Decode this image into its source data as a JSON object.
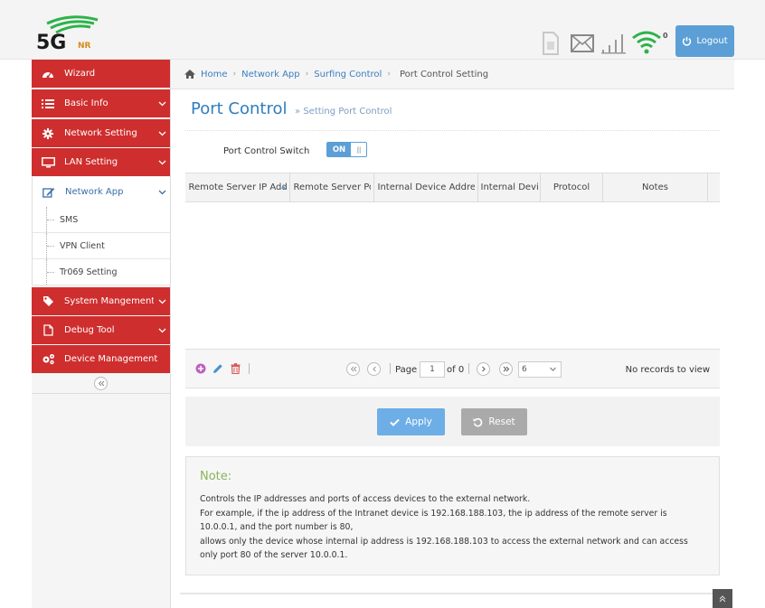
{
  "header": {
    "logo_text": "5G",
    "logo_sub": "NR",
    "wifi_count": "0",
    "logout_label": "Logout"
  },
  "sidebar": {
    "items": [
      {
        "label": "Wizard",
        "icon": "dashboard-icon"
      },
      {
        "label": "Basic Info",
        "icon": "list-icon"
      },
      {
        "label": "Network Setting",
        "icon": "gear-icon"
      },
      {
        "label": "LAN Setting",
        "icon": "monitor-icon"
      },
      {
        "label": "Network App",
        "icon": "edit-icon"
      },
      {
        "label": "System Mangement",
        "icon": "tag-icon"
      },
      {
        "label": "Debug Tool",
        "icon": "file-icon"
      },
      {
        "label": "Device Management",
        "icon": "gears-icon"
      }
    ],
    "sub_items": [
      "SMS",
      "VPN Client",
      "Tr069 Setting"
    ]
  },
  "breadcrumb": {
    "home": "Home",
    "level1": "Network App",
    "level2": "Surfing Control",
    "current": "Port Control Setting"
  },
  "page": {
    "title": "Port Control",
    "subtitle": "Setting Port Control",
    "switch_label": "Port Control Switch",
    "switch_state": "ON"
  },
  "table": {
    "columns": [
      "Remote Server IP Address",
      "Remote Server Port",
      "Internal Device Address",
      "Internal Device Port",
      "Protocol",
      "Notes"
    ]
  },
  "pager": {
    "page_label": "Page",
    "page_value": "1",
    "of_label": "of 0",
    "rows_value": "6",
    "empty_text": "No records to view"
  },
  "buttons": {
    "apply": "Apply",
    "reset": "Reset"
  },
  "note": {
    "title": "Note:",
    "lines": [
      "Controls the IP addresses and ports of access devices to the external network.",
      "For example, if the ip address of the Intranet device is 192.168.188.103, the ip address of the remote server is 10.0.0.1, and the port number is 80,",
      "allows only the device whose internal ip address is 192.168.188.103 to access the external network and can access only port 80 of the server 10.0.0.1."
    ]
  },
  "colors": {
    "brand_red": "#cf2e2e",
    "accent_blue": "#5b9fd6",
    "wifi_green": "#2db34a",
    "note_green": "#8ab45a"
  }
}
